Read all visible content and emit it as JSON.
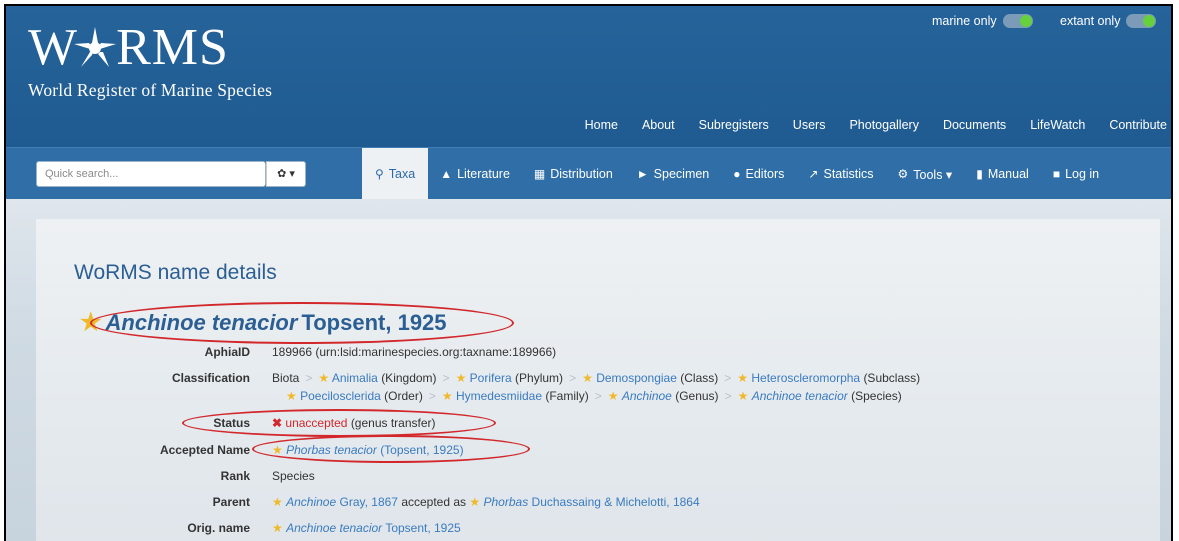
{
  "logo": {
    "title_left": "W",
    "title_right": "RMS",
    "subtitle": "World Register of Marine Species"
  },
  "toggles": [
    {
      "label": "marine only"
    },
    {
      "label": "extant only"
    }
  ],
  "top_nav": [
    "Home",
    "About",
    "Subregisters",
    "Users",
    "Photogallery",
    "Documents",
    "LifeWatch",
    "Contribute"
  ],
  "search": {
    "placeholder": "Quick search...",
    "options_label": "✿ ▾"
  },
  "tabs": [
    {
      "label": "Taxa",
      "icon": "search-icon",
      "active": true
    },
    {
      "label": "Literature",
      "icon": "graduation-cap-icon"
    },
    {
      "label": "Distribution",
      "icon": "map-icon"
    },
    {
      "label": "Specimen",
      "icon": "tag-icon"
    },
    {
      "label": "Editors",
      "icon": "users-icon"
    },
    {
      "label": "Statistics",
      "icon": "line-chart-icon"
    },
    {
      "label": "Tools ▾",
      "icon": "gears-icon"
    },
    {
      "label": "Manual",
      "icon": "book-icon"
    },
    {
      "label": "Log in",
      "icon": "lock-icon"
    }
  ],
  "page_title": "WoRMS name details",
  "species": {
    "name": "Anchinoe tenacior",
    "authority": "Topsent, 1925"
  },
  "details": {
    "aphiaid_label": "AphiaID",
    "aphiaid_value": "189966",
    "aphiaid_urn": "(urn:lsid:marinespecies.org:taxname:189966)",
    "classification_label": "Classification",
    "classification_line1": [
      {
        "name": "Biota",
        "rank": "",
        "link": false,
        "star": false
      },
      {
        "name": "Animalia",
        "rank": "(Kingdom)",
        "link": true,
        "star": true
      },
      {
        "name": "Porifera",
        "rank": "(Phylum)",
        "link": true,
        "star": true
      },
      {
        "name": "Demospongiae",
        "rank": "(Class)",
        "link": true,
        "star": true
      },
      {
        "name": "Heteroscleromorpha",
        "rank": "(Subclass)",
        "link": true,
        "star": true
      }
    ],
    "classification_line2": [
      {
        "name": "Poecilosclerida",
        "rank": "(Order)",
        "link": true,
        "star": true,
        "italic": false
      },
      {
        "name": "Hymedesmiidae",
        "rank": "(Family)",
        "link": true,
        "star": true,
        "italic": false
      },
      {
        "name": "Anchinoe",
        "rank": "(Genus)",
        "link": true,
        "star": true,
        "italic": true
      },
      {
        "name": "Anchinoe tenacior",
        "rank": "(Species)",
        "link": true,
        "star": true,
        "italic": true
      }
    ],
    "status_label": "Status",
    "status_value": "unaccepted",
    "status_note": "(genus transfer)",
    "accepted_label": "Accepted Name",
    "accepted_name": "Phorbas tenacior",
    "accepted_authority": "(Topsent, 1925)",
    "rank_label": "Rank",
    "rank_value": "Species",
    "parent_label": "Parent",
    "parent_name": "Anchinoe",
    "parent_authority": "Gray, 1867",
    "parent_accepted_as": "accepted as",
    "parent_accepted_name": "Phorbas",
    "parent_accepted_authority": "Duchassaing & Michelotti, 1864",
    "orig_label": "Orig. name",
    "orig_name": "Anchinoe tenacior",
    "orig_authority": "Topsent, 1925"
  },
  "colors": {
    "header": "#1f5b90",
    "navbar": "#2f6ea6",
    "link": "#3a7bbf",
    "star": "#f0b92a",
    "annotation": "#d2282c"
  }
}
